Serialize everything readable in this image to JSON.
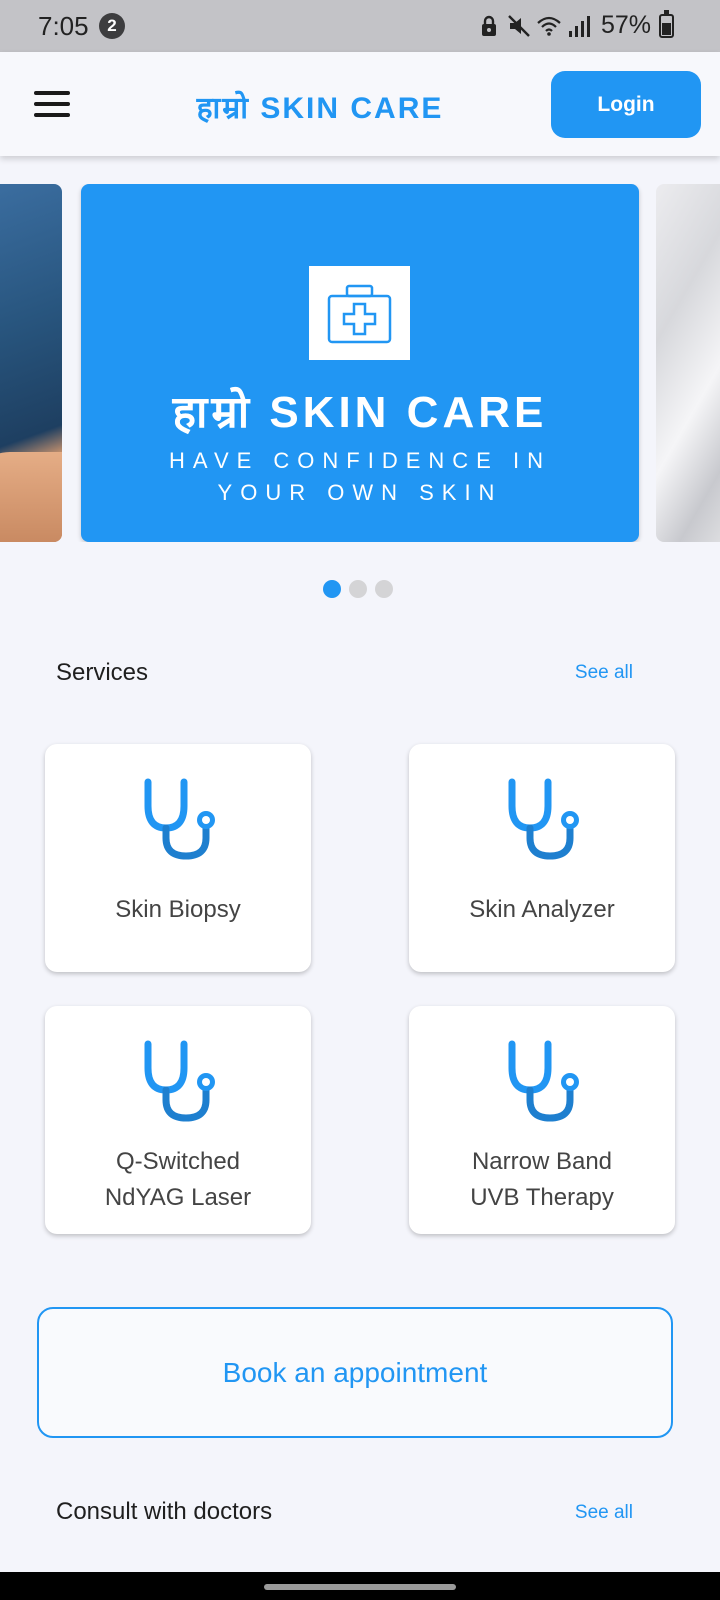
{
  "status_bar": {
    "time": "7:05",
    "notification_count": "2",
    "battery_percent": "57%",
    "icons": [
      "lock-icon",
      "mute-icon",
      "wifi-icon",
      "signal-icon",
      "battery-icon"
    ]
  },
  "app_bar": {
    "brand": "हाम्रो SKIN CARE",
    "login_label": "Login",
    "menu_icon": "hamburger-menu-icon"
  },
  "banner": {
    "title": "हाम्रो SKIN CARE",
    "tagline_line1": "HAVE CONFIDENCE IN",
    "tagline_line2": "YOUR OWN SKIN",
    "icon": "medical-kit-icon",
    "slide_count": 3,
    "active_slide": 1
  },
  "services": {
    "title": "Services",
    "see_all": "See all",
    "items": [
      {
        "label": "Skin Biopsy",
        "icon": "stethoscope-icon"
      },
      {
        "label": "Skin Analyzer",
        "icon": "stethoscope-icon"
      },
      {
        "label_line1": "Q-Switched",
        "label_line2": "NdYAG Laser",
        "icon": "stethoscope-icon"
      },
      {
        "label_line1": "Narrow Band",
        "label_line2": "UVB Therapy",
        "icon": "stethoscope-icon"
      }
    ]
  },
  "book_appointment_label": "Book an appointment",
  "doctors": {
    "title": "Consult with doctors",
    "see_all": "See all"
  },
  "colors": {
    "accent": "#2196f3",
    "background": "#f4f5fb",
    "status_bar": "#c3c3c7"
  }
}
